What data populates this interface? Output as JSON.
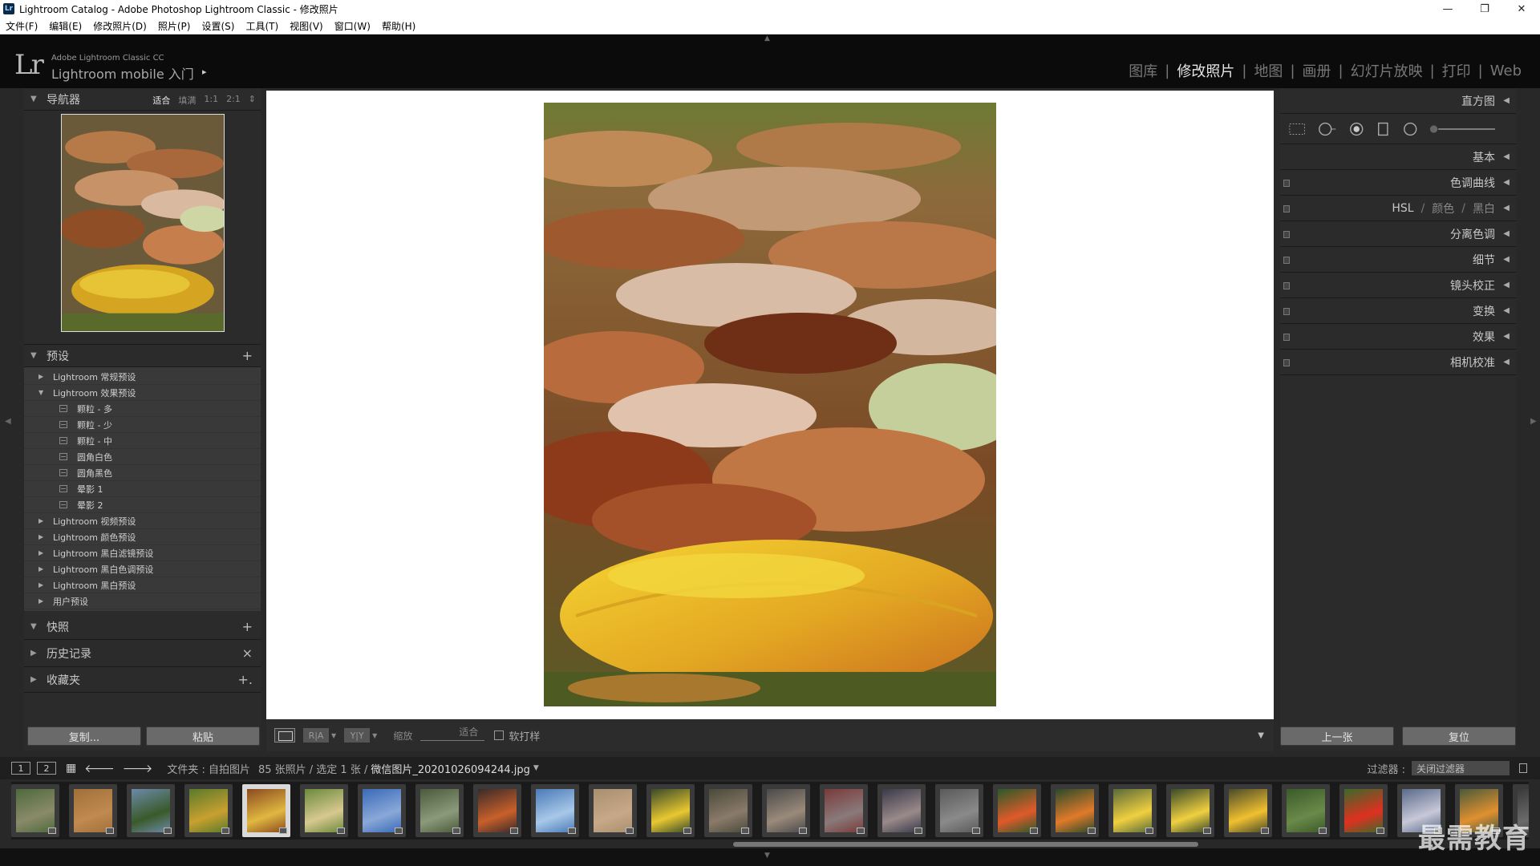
{
  "window": {
    "title": "Lightroom Catalog - Adobe Photoshop Lightroom Classic - 修改照片",
    "icon_text": "Lr",
    "controls": [
      "minimize-icon",
      "restore-icon",
      "close-icon"
    ]
  },
  "menu": [
    "文件(F)",
    "编辑(E)",
    "修改照片(D)",
    "照片(P)",
    "设置(S)",
    "工具(T)",
    "视图(V)",
    "窗口(W)",
    "帮助(H)"
  ],
  "identity": {
    "logo": "Lr",
    "product": "Adobe Lightroom Classic CC",
    "subtitle": "Lightroom mobile 入门",
    "arrow": "▸"
  },
  "modules": [
    {
      "label": "图库",
      "active": false
    },
    {
      "label": "修改照片",
      "active": true
    },
    {
      "label": "地图",
      "active": false
    },
    {
      "label": "画册",
      "active": false
    },
    {
      "label": "幻灯片放映",
      "active": false
    },
    {
      "label": "打印",
      "active": false
    },
    {
      "label": "Web",
      "active": false
    }
  ],
  "navigator": {
    "title": "导航器",
    "zoom_options": [
      {
        "label": "适合",
        "active": true
      },
      {
        "label": "填满",
        "active": false
      },
      {
        "label": "1:1",
        "active": false
      },
      {
        "label": "2:1",
        "active": false
      }
    ]
  },
  "presets": {
    "title": "预设",
    "add": "+",
    "items": [
      {
        "label": "Lightroom 常规预设",
        "expanded": false,
        "level": 0
      },
      {
        "label": "Lightroom 效果预设",
        "expanded": true,
        "level": 0
      },
      {
        "label": "颗粒 - 多",
        "level": 1
      },
      {
        "label": "颗粒 - 少",
        "level": 1
      },
      {
        "label": "颗粒 - 中",
        "level": 1
      },
      {
        "label": "圆角白色",
        "level": 1
      },
      {
        "label": "圆角黑色",
        "level": 1
      },
      {
        "label": "晕影 1",
        "level": 1
      },
      {
        "label": "晕影 2",
        "level": 1
      },
      {
        "label": "Lightroom 视频预设",
        "expanded": false,
        "level": 0
      },
      {
        "label": "Lightroom 颜色预设",
        "expanded": false,
        "level": 0
      },
      {
        "label": "Lightroom 黑白滤镜预设",
        "expanded": false,
        "level": 0
      },
      {
        "label": "Lightroom 黑白色调预设",
        "expanded": false,
        "level": 0
      },
      {
        "label": "Lightroom 黑白预设",
        "expanded": false,
        "level": 0
      },
      {
        "label": "用户预设",
        "expanded": false,
        "level": 0
      }
    ]
  },
  "snapshots": {
    "title": "快照",
    "action": "+"
  },
  "history": {
    "title": "历史记录",
    "action": "×"
  },
  "collections": {
    "title": "收藏夹",
    "action": "+."
  },
  "left_buttons": {
    "copy": "复制...",
    "paste": "粘贴"
  },
  "toolbar": {
    "ry1": "R|A",
    "ry2": "Y|Y",
    "zoom_label": "缩放",
    "zoom_value": "适合",
    "softproof": "软打样"
  },
  "right_panel": {
    "histogram": "直方图",
    "basic": "基本",
    "tone_curve": "色调曲线",
    "hsl": "HSL",
    "color": "颜色",
    "bw": "黑白",
    "hsl_sep": "/",
    "split_toning": "分离色调",
    "detail": "细节",
    "lens": "镜头校正",
    "transform": "变换",
    "effects": "效果",
    "calibration": "相机校准",
    "prev_button": "上一张",
    "reset_button": "复位"
  },
  "filmstrip": {
    "monitor1": "1",
    "monitor2": "2",
    "folder_label": "文件夹 : 自拍图片",
    "count_label": "85 张照片 / 选定 1 张 /",
    "filename": "微信图片_20201026094244.jpg",
    "filter_label": "过滤器 :",
    "filter_value": "关闭过滤器",
    "selected_index": 4,
    "thumb_count": 27
  },
  "watermark": "最需教育"
}
